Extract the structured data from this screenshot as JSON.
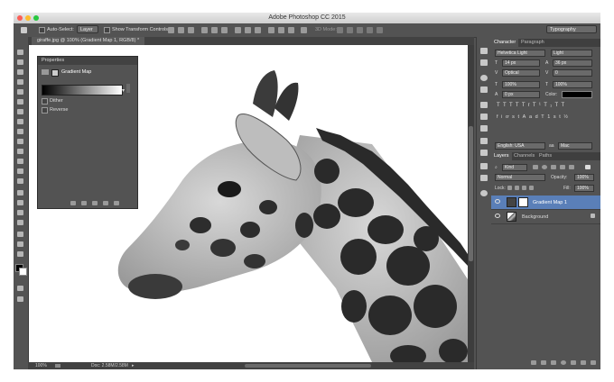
{
  "window": {
    "title": "Adobe Photoshop CC 2015"
  },
  "options_bar": {
    "auto_select_label": "Auto-Select:",
    "auto_select_value": "Layer",
    "show_transform_label": "Show Transform Controls",
    "mode_3d_label": "3D Mode:",
    "workspace_value": "Typography"
  },
  "document_tab": {
    "label": "giraffe.jpg @ 100% (Gradient Map 1, RGB/8) *"
  },
  "status_bar": {
    "zoom": "100%",
    "doc_size": "Doc: 2.58M/2.58M"
  },
  "properties_panel": {
    "title": "Properties",
    "adjustment_name": "Gradient Map",
    "dither_label": "Dither",
    "reverse_label": "Reverse"
  },
  "character_panel": {
    "tabs": [
      "Character",
      "Paragraph"
    ],
    "font_family": "Helvetica Light",
    "font_style": "Light",
    "font_size": "14 px",
    "leading": "36 px",
    "kerning": "Optical",
    "tracking": "0",
    "vertical_scale": "100%",
    "horizontal_scale": "100%",
    "baseline_shift": "0 px",
    "color_label": "Color:",
    "language": "English: USA",
    "antialias": "Mac",
    "type_buttons": [
      "T",
      "T",
      "TT",
      "Tr",
      "T¹",
      "T₁",
      "T",
      "T"
    ],
    "opentype_buttons": [
      "fi",
      "ơ",
      "st",
      "A",
      "ad",
      "T",
      "1st",
      "½"
    ]
  },
  "layers_panel": {
    "tabs": [
      "Layers",
      "Channels",
      "Paths"
    ],
    "filter_kind": "Kind",
    "blend_mode": "Normal",
    "opacity_label": "Opacity:",
    "opacity_value": "100%",
    "lock_label": "Lock:",
    "fill_label": "Fill:",
    "fill_value": "100%",
    "layers": [
      {
        "name": "Gradient Map 1",
        "selected": true
      },
      {
        "name": "Background",
        "selected": false
      }
    ]
  },
  "colors": {
    "accent_selected_layer": "#5a7fb8",
    "canvas": "#ffffff",
    "ui_bg": "#535353"
  }
}
